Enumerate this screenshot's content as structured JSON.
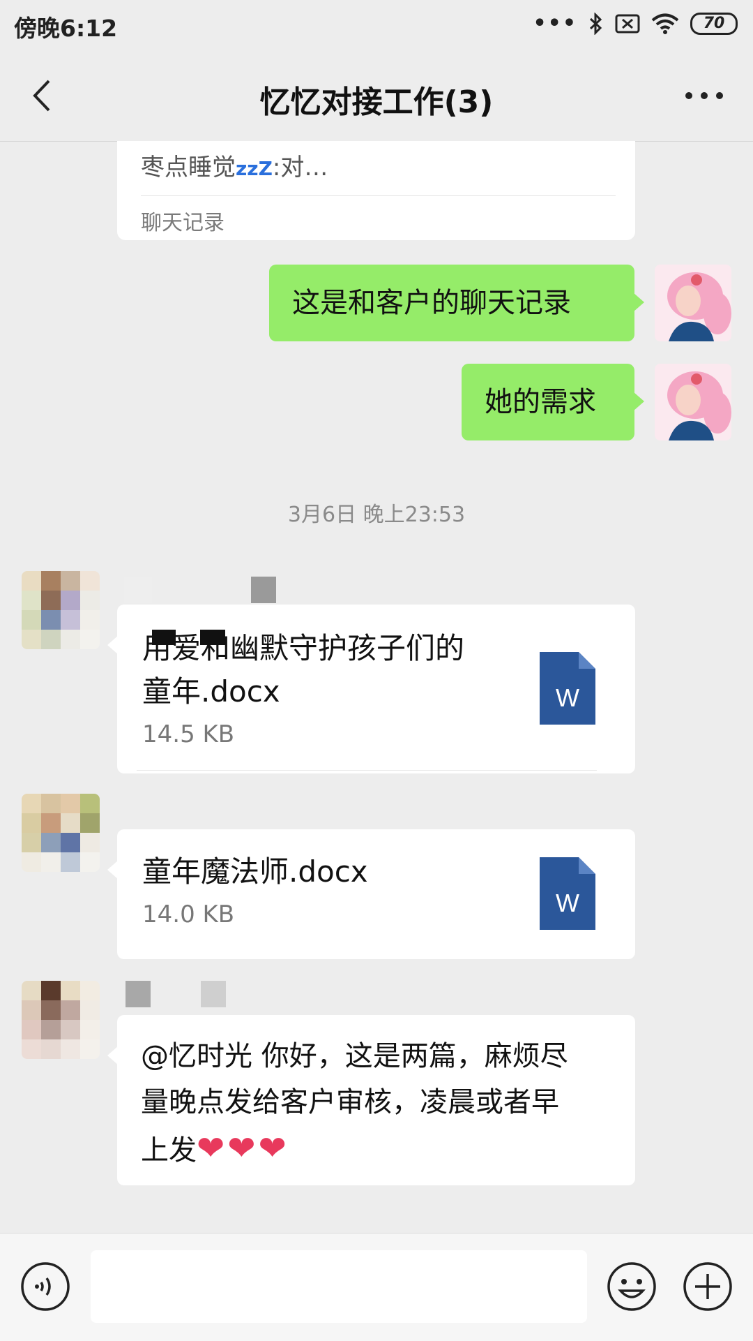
{
  "status_bar": {
    "time": "傍晚6:12",
    "battery": "70"
  },
  "nav": {
    "title": "忆忆对接工作(3)"
  },
  "chat_record": {
    "preview": "枣点睡觉",
    "zzz": "zzZ",
    "preview_suffix": ":对…",
    "label": "聊天记录"
  },
  "messages": {
    "m1": "这是和客户的聊天记录",
    "m2": "她的需求"
  },
  "timestamp": "3月6日 晚上23:53",
  "file1": {
    "name_line1": "用爱和幽默守护孩子们的",
    "name_line2": "童年.docx",
    "size": "14.5 KB",
    "icon_letter": "W"
  },
  "file2": {
    "name": "童年魔法师.docx",
    "size": "14.0 KB",
    "icon_letter": "W"
  },
  "text_msg": {
    "line1": "@忆时光  你好，这是两篇，麻烦尽",
    "line2": "量晚点发给客户审核，凌晨或者早",
    "line3": "上发",
    "hearts": "❤❤❤"
  },
  "colors": {
    "green_bubble": "#95ec69",
    "word_blue": "#2b579a",
    "background": "#ededed"
  }
}
